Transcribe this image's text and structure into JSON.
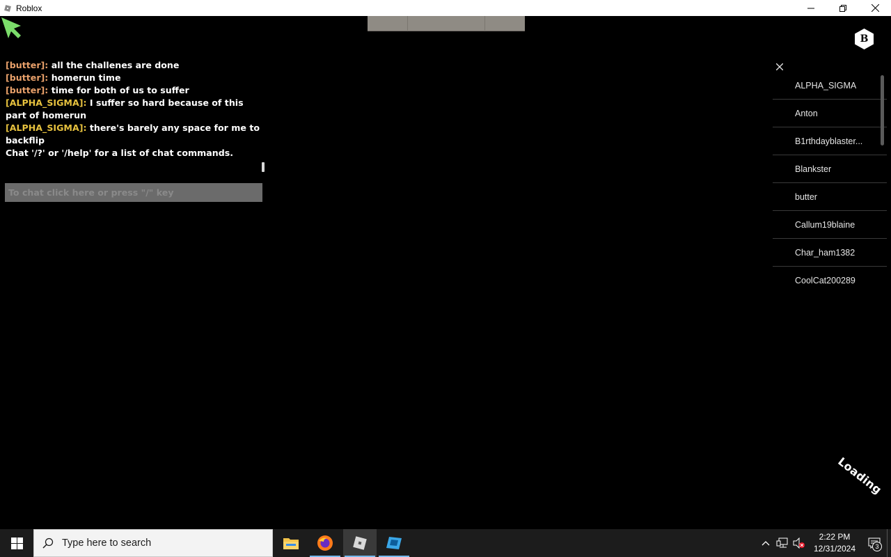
{
  "window": {
    "title": "Roblox"
  },
  "hud": {
    "badge_letter": "B",
    "loading_text": "Loading"
  },
  "chat": {
    "messages": [
      {
        "speaker": "[butter]:",
        "text": " all the challenes are done",
        "speaker_color": "#e8a06a"
      },
      {
        "speaker": "[butter]:",
        "text": " homerun time",
        "speaker_color": "#e8a06a"
      },
      {
        "speaker": "[butter]:",
        "text": " time for both of us to suffer",
        "speaker_color": "#e8a06a"
      },
      {
        "speaker": "[ALPHA_SIGMA]:",
        "text": " I suffer so hard because of this part of homerun",
        "speaker_color": "#e6c13e"
      },
      {
        "speaker": "[ALPHA_SIGMA]:",
        "text": " there's barely any space for me to backflip",
        "speaker_color": "#e6c13e"
      }
    ],
    "system_message": "Chat '/?' or '/help' for a list of chat commands.",
    "input_placeholder": "To chat click here or press \"/\" key"
  },
  "player_list": {
    "players": [
      "ALPHA_SIGMA",
      "Anton",
      "B1rthdayblaster...",
      "Blankster",
      "butter",
      "Callum19blaine",
      "Char_ham1382",
      "CoolCat200289"
    ]
  },
  "taskbar": {
    "search_placeholder": "Type here to search",
    "apps": [
      "file-explorer",
      "firefox",
      "roblox-player",
      "roblox-studio"
    ],
    "clock_time": "2:22 PM",
    "clock_date": "12/31/2024",
    "notification_count": "3"
  },
  "colors": {
    "butter": "#e8a06a",
    "alpha_sigma": "#e6c13e",
    "taskbar_bg": "#1c1c1c",
    "accent": "#76b9ed"
  }
}
